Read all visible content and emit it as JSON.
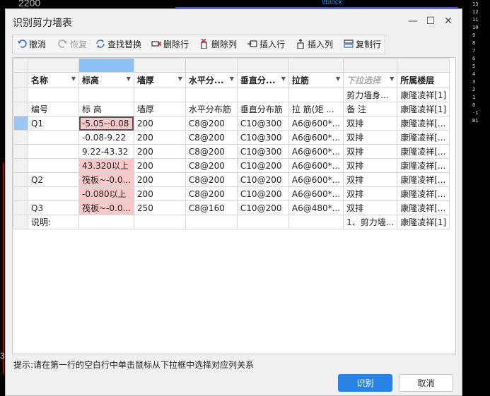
{
  "background": {
    "top_number": "2200",
    "top_mark": "\\tblock",
    "left_number": "3",
    "right_labels": [
      "13",
      "12",
      "11",
      "10",
      "9",
      "8",
      "7",
      "6",
      "5",
      "4",
      "3",
      "2",
      "1",
      "0",
      "-1",
      "B1"
    ]
  },
  "dialog": {
    "title": "识别剪力墙表",
    "window_buttons": {
      "minimize": "—",
      "maximize": "☐",
      "close": "✕"
    }
  },
  "toolbar": {
    "items": [
      {
        "label": "撤消",
        "icon": "undo-icon",
        "enabled": true
      },
      {
        "label": "恢复",
        "icon": "redo-icon",
        "enabled": false
      },
      {
        "label": "查找替换",
        "icon": "find-replace-icon",
        "enabled": true
      },
      {
        "label": "删除行",
        "icon": "delete-row-icon",
        "enabled": true
      },
      {
        "label": "删除列",
        "icon": "delete-column-icon",
        "enabled": true
      },
      {
        "label": "插入行",
        "icon": "insert-row-icon",
        "enabled": true
      },
      {
        "label": "插入列",
        "icon": "insert-column-icon",
        "enabled": true
      },
      {
        "label": "复制行",
        "icon": "copy-row-icon",
        "enabled": true
      }
    ]
  },
  "table": {
    "headers": [
      {
        "label": "名称",
        "dropdown": true
      },
      {
        "label": "标高",
        "dropdown": true
      },
      {
        "label": "墙厚",
        "dropdown": true
      },
      {
        "label": "水平分...",
        "dropdown": true
      },
      {
        "label": "垂直分...",
        "dropdown": true
      },
      {
        "label": "拉筋",
        "dropdown": true
      },
      {
        "label": "下拉选择",
        "dropdown": true,
        "placeholder": true
      },
      {
        "label": "所属楼层",
        "dropdown": false
      }
    ],
    "rows": [
      [
        "",
        "",
        "",
        "",
        "",
        "",
        "剪力墙身...",
        "康隆凌祥[1]"
      ],
      [
        "编号",
        "标  高",
        "墙厚",
        "水平分布筋",
        "垂直分布筋",
        "拉  筋(矩 ...",
        "备  注",
        "康隆凌祥[1]"
      ],
      [
        "Q1",
        "-5.05--0.08",
        "200",
        "C8@200",
        "C10@300",
        "A6@600*...",
        "双排",
        "康隆凌祥[..."
      ],
      [
        "",
        "-0.08-9.22",
        "200",
        "C8@200",
        "C10@300",
        "A6@600*...",
        "双排",
        "康隆凌祥[..."
      ],
      [
        "",
        "9.22-43.32",
        "200",
        "C8@200",
        "C10@300",
        "A6@600*...",
        "双排",
        "康隆凌祥[..."
      ],
      [
        "",
        "43.320以上",
        "200",
        "C8@200",
        "C10@200",
        "A6@600*...",
        "双排",
        "康隆凌祥[..."
      ],
      [
        "Q2",
        "筏板~-0.0...",
        "200",
        "C8@200",
        "C10@200",
        "A6@600*...",
        "双排",
        "康隆凌祥[..."
      ],
      [
        "",
        "-0.080以上",
        "200",
        "C8@200",
        "C10@200",
        "A6@600*...",
        "双排",
        "康隆凌祥[..."
      ],
      [
        "Q3",
        "筏板~-0.0...",
        "250",
        "C8@160",
        "C10@200",
        "A6@480*...",
        "双排",
        "康隆凌祥[..."
      ],
      [
        "说明:",
        "",
        "",
        "",
        "",
        "",
        "1、剪力墙...",
        "康隆凌祥[1]"
      ]
    ]
  },
  "hint": "提示:请在第一行的空白行中单击鼠标从下拉框中选择对应列关系",
  "buttons": {
    "confirm": "识别",
    "cancel": "取消"
  },
  "colors": {
    "primary_button": "#2a82e4",
    "selected_column": "#8ec2f5",
    "highlight_cell": "#f9c9c9"
  }
}
